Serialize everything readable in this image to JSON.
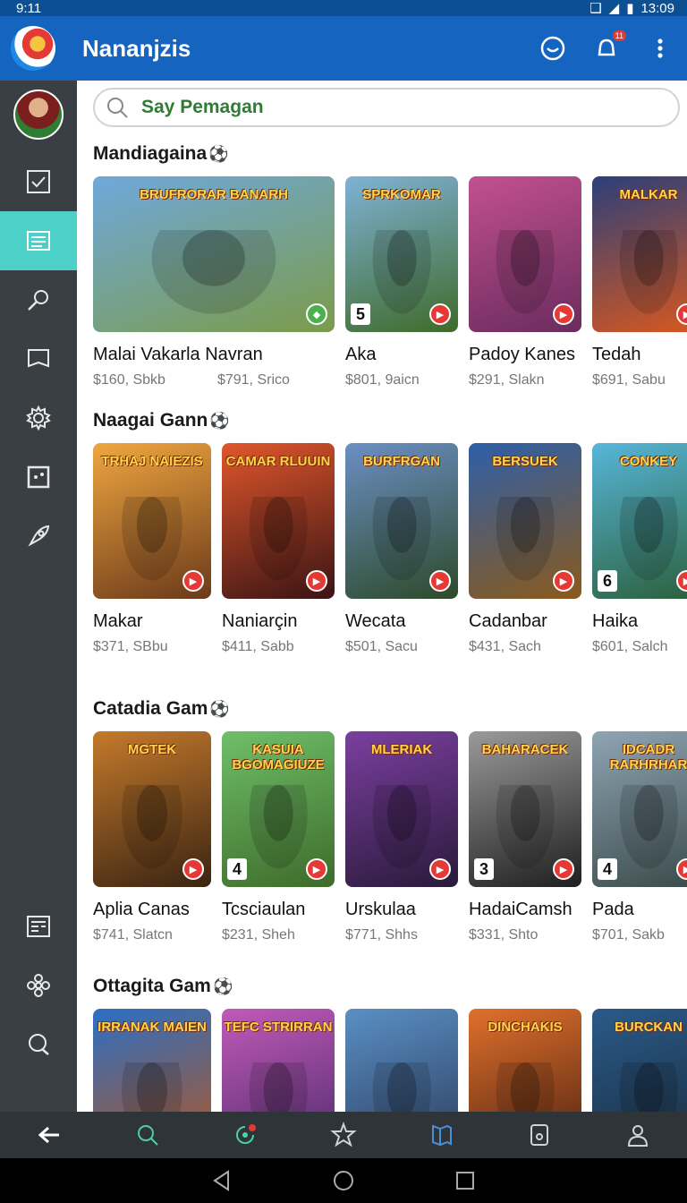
{
  "status_bar": {
    "time": "9:11",
    "clock": "13:09"
  },
  "header": {
    "title": "Nananjzis",
    "notification_count": "11"
  },
  "search": {
    "placeholder": "Say Pemagan"
  },
  "sections": [
    {
      "title": "Mandiagaina",
      "cards": [
        {
          "name": "Malai Vakarla Navran",
          "price1": "$160, Sbkb",
          "price2": "$791, Srico",
          "art_title": "BRUFRORAR BANARH",
          "colors": [
            "#6fa8dc",
            "#7b9b4a"
          ]
        },
        {
          "name": "Aka",
          "price1": "$801, 9aicn",
          "art_title": "SPRKOMAR",
          "badge": "5",
          "colors": [
            "#7fb2d6",
            "#3f6b2a"
          ]
        },
        {
          "name": "Padoy Kanes",
          "price1": "$291, Slakn",
          "colors": [
            "#c2508f",
            "#6a2c5e"
          ]
        },
        {
          "name": "Tedah",
          "price1": "$691, Sabu",
          "art_title": "MALKAR",
          "colors": [
            "#2b3f7a",
            "#d9581e"
          ]
        }
      ]
    },
    {
      "title": "Naagai Gann",
      "cards": [
        {
          "name": "Makar",
          "price1": "$371, SBbu",
          "art_title": "TRHAJ NAIEZIS",
          "colors": [
            "#f0a640",
            "#6b3a1a"
          ]
        },
        {
          "name": "Naniarçin",
          "price1": "$411, Sabb",
          "art_title": "CAMAR RLUUIN",
          "colors": [
            "#e0562c",
            "#3a1414"
          ]
        },
        {
          "name": "Wecata",
          "price1": "$501, Sacu",
          "art_title": "BURFRGAN",
          "colors": [
            "#6b8fc4",
            "#2d4a2a"
          ]
        },
        {
          "name": "Cadanbar",
          "price1": "$431, Sach",
          "art_title": "BERSUEK",
          "colors": [
            "#2e5fa8",
            "#8a5a1c"
          ]
        },
        {
          "name": "Haika",
          "price1": "$601, Salch",
          "art_title": "CONKEY",
          "badge": "6",
          "colors": [
            "#57b6d9",
            "#2b5f3a"
          ]
        }
      ]
    },
    {
      "title": "Catadia Gam",
      "cards": [
        {
          "name": "Aplia Canas",
          "price1": "$741, Slatcn",
          "art_title": "MGTEK",
          "colors": [
            "#c57a2c",
            "#3a2412"
          ]
        },
        {
          "name": "Tcsciaulan",
          "price1": "$231, Sheh",
          "art_title": "KASUIA BGOMAGIUZE",
          "badge": "4",
          "colors": [
            "#6fbf6a",
            "#3e6b2a"
          ]
        },
        {
          "name": "Urskulaa",
          "price1": "$771, Shhs",
          "art_title": "MLERIAK",
          "colors": [
            "#7b3fa0",
            "#2a1a3a"
          ]
        },
        {
          "name": "HadaiCamsh",
          "price1": "$331, Shto",
          "art_title": "BAHARACEK",
          "badge": "3",
          "colors": [
            "#9a9a9a",
            "#1f1f1f"
          ]
        },
        {
          "name": "Pada",
          "price1": "$701, Sakb",
          "art_title": "IDCADR RARHRHAR",
          "badge": "4",
          "colors": [
            "#8fa5b4",
            "#3a4a4a"
          ]
        }
      ]
    },
    {
      "title": "Ottagita Gam",
      "cards": [
        {
          "name": "",
          "price1": "",
          "art_title": "IRRANAK MAIEN",
          "colors": [
            "#2b6fc4",
            "#b5561e"
          ]
        },
        {
          "name": "",
          "price1": "",
          "art_title": "TEFC STRIRRAN",
          "colors": [
            "#c25ab8",
            "#4a2a6a"
          ]
        },
        {
          "name": "",
          "price1": "",
          "colors": [
            "#5a8fc4",
            "#2a3a5a"
          ]
        },
        {
          "name": "",
          "price1": "",
          "art_title": "DINCHAKIS",
          "colors": [
            "#e0702c",
            "#4a2010"
          ]
        },
        {
          "name": "",
          "price1": "",
          "art_title": "BURCKAN",
          "colors": [
            "#2a5a8a",
            "#1a2a3a"
          ]
        }
      ]
    }
  ],
  "sidebar_icons": [
    "checkbox-icon",
    "list-icon",
    "search-tool-icon",
    "book-icon",
    "gear-icon",
    "dice-icon",
    "rocket-icon",
    "news-icon",
    "flower-icon",
    "chat-icon"
  ],
  "bottom_nav_icons": [
    "back-arrow-icon",
    "search-icon",
    "refresh-icon",
    "star-icon",
    "map-icon",
    "wallet-icon",
    "profile-icon"
  ]
}
